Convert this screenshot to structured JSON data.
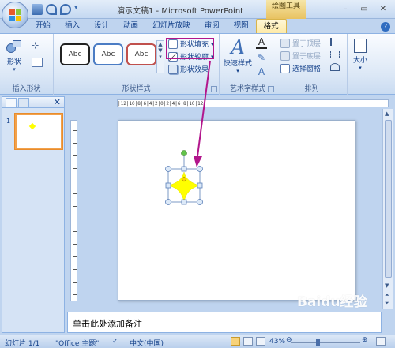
{
  "window": {
    "title": "演示文稿1 - Microsoft PowerPoint",
    "context_tab_title": "绘图工具",
    "controls": [
      "–",
      "▭",
      "✕"
    ]
  },
  "tabs": [
    "开始",
    "插入",
    "设计",
    "动画",
    "幻灯片放映",
    "审阅",
    "视图",
    "格式"
  ],
  "ribbon": {
    "insert_shapes": {
      "shapes_label": "形状",
      "group_label": "插入形状"
    },
    "shape_styles": {
      "style_samples": [
        "Abc",
        "Abc",
        "Abc"
      ],
      "fill_label": "形状填充",
      "outline_label": "形状轮廓",
      "effects_label": "形状效果",
      "group_label": "形状样式"
    },
    "wordart": {
      "quick_styles_label": "快速样式",
      "group_label": "艺术字样式"
    },
    "arrange": {
      "bring_front_label": "置于顶层",
      "send_back_label": "置于底层",
      "selection_pane_label": "选择窗格",
      "group_label": "排列"
    },
    "size": {
      "label": "大小"
    }
  },
  "slides_panel": {
    "slide_number": "1"
  },
  "ruler": {
    "text": "|12|10|8|6|4|2|0|2|4|6|8|10|12|"
  },
  "notes": {
    "placeholder": "单击此处添加备注"
  },
  "status": {
    "slide_count": "幻灯片 1/1",
    "theme": "\"Office 主题\"",
    "language": "中文(中国)",
    "zoom": "43%"
  },
  "watermark": {
    "text": "Baidu经验",
    "url": "jingyan.baidu.com"
  },
  "colors": {
    "highlight": "#b2168c",
    "shape_fill": "#ffff00",
    "selection_handle": "#7ba6d8",
    "rotate_handle": "#62c34a",
    "slide_thumb_border": "#f2a14b"
  }
}
